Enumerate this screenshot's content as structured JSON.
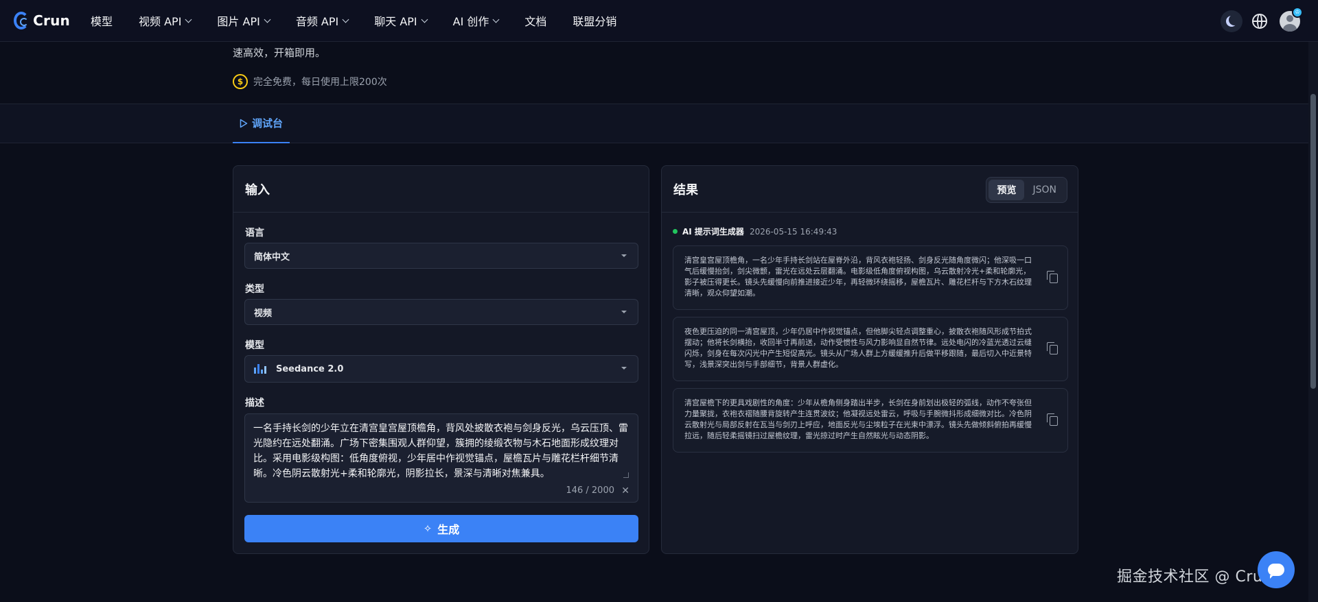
{
  "nav": {
    "logo_text": "Crun",
    "items": [
      {
        "label": "模型",
        "has_dropdown": false
      },
      {
        "label": "视频 API",
        "has_dropdown": true
      },
      {
        "label": "图片 API",
        "has_dropdown": true
      },
      {
        "label": "音频 API",
        "has_dropdown": true
      },
      {
        "label": "聊天 API",
        "has_dropdown": true
      },
      {
        "label": "AI 创作",
        "has_dropdown": true
      },
      {
        "label": "文档",
        "has_dropdown": false
      },
      {
        "label": "联盟分销",
        "has_dropdown": false
      }
    ],
    "avatar_badge": "♔"
  },
  "header": {
    "intro": "速高效，开箱即用。",
    "free_icon": "$",
    "free_text": "完全免费，每日使用上限200次"
  },
  "tabs": {
    "active_label": "调试台"
  },
  "input_panel": {
    "title": "输入",
    "language": {
      "label": "语言",
      "value": "简体中文"
    },
    "type": {
      "label": "类型",
      "value": "视频"
    },
    "model": {
      "label": "模型",
      "value": "Seedance 2.0"
    },
    "description": {
      "label": "描述",
      "value": "一名手持长剑的少年立在清宫皇宫屋顶檐角，背风处披散衣袍与剑身反光，乌云压顶、雷光隐约在远处翻涌。广场下密集围观人群仰望，簇拥的绫缎衣物与木石地面形成纹理对比。采用电影级构图：低角度俯视，少年居中作视觉锚点，屋檐瓦片与雕花栏杆细节清晰。冷色阴云散射光+柔和轮廓光，阴影拉长，景深与清晰对焦兼具。",
      "counter": "146 / 2000",
      "clear_icon": "✕"
    },
    "generate_label": "生成",
    "generate_icon": "✧"
  },
  "result_panel": {
    "title": "结果",
    "toggle": {
      "preview": "预览",
      "json": "JSON"
    },
    "meta": {
      "source": "AI 提示词生成器",
      "time": "2026-05-15 16:49:43",
      "status_color": "#22c55e"
    },
    "results": [
      "清宫皇宫屋顶檐角，一名少年手持长剑站在屋脊外沿，背风衣袍轻扬、剑身反光随角度微闪；他深吸一口气后缓慢抬剑，剑尖微颤，雷光在远处云层翻涌。电影级低角度俯视构图，乌云散射冷光+柔和轮廓光，影子被压得更长。镜头先缓慢向前推进接近少年，再轻微环绕摇移，屋檐瓦片、雕花栏杆与下方木石纹理清晰，观众仰望如潮。",
      "夜色更压迫的同一清宫屋顶，少年仍居中作视觉锚点，但他脚尖轻点调整重心，披散衣袍随风形成节拍式摆动；他将长剑横抬，收回半寸再前送，动作受惯性与风力影响显自然节律。远处电闪的冷蓝光透过云缝闪烁，剑身在每次闪光中产生短促高光。镜头从广场人群上方缓缓推升后做平移跟随，最后切入中近景特写，浅景深突出剑与手部细节，背景人群虚化。",
      "清宫屋檐下的更具戏剧性的角度：少年从檐角侧身踏出半步，长剑在身前划出极轻的弧线，动作不夸张但力量聚拢，衣袍衣褶随腰背旋转产生连贯波纹；他凝视远处雷云，呼吸与手腕微抖形成细微对比。冷色阴云散射光与局部反射在瓦当与剑刃上呼应，地面反光与尘埃粒子在光束中漂浮。镜头先做倾斜俯拍再缓慢拉远，随后轻柔摇镜扫过屋檐纹理，雷光掠过时产生自然眩光与动态阴影。"
    ]
  },
  "footer": {
    "watermark": "掘金技术社区 @ CrunAI"
  },
  "colors": {
    "accent": "#3b82f6",
    "background": "#0b0e1a",
    "panel": "#141826"
  }
}
